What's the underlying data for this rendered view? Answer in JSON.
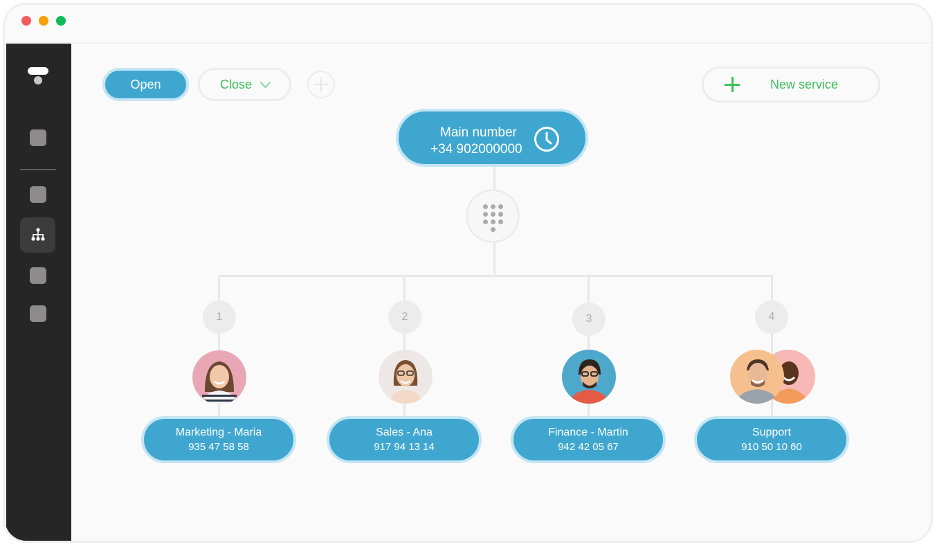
{
  "window": {
    "controls": [
      "close",
      "minimize",
      "maximize"
    ]
  },
  "sidebar": {
    "logo": "app-logo",
    "items": [
      {
        "name": "nav-item-1",
        "active": false
      },
      {
        "name": "nav-item-2",
        "active": false
      },
      {
        "name": "nav-item-call-flow",
        "icon": "org-chart-icon",
        "active": true
      },
      {
        "name": "nav-item-4",
        "active": false
      },
      {
        "name": "nav-item-5",
        "active": false
      }
    ]
  },
  "toolbar": {
    "open_label": "Open",
    "close_label": "Close",
    "add_icon": "plus-circle-icon",
    "new_service_label": "New service"
  },
  "flow": {
    "main": {
      "title": "Main number",
      "number": "+34 902000000",
      "icon": "clock-icon"
    },
    "menu_icon": "keypad-icon",
    "branches": [
      {
        "option": "1",
        "name": "Marketing - Maria",
        "phone": "935 47 58 58",
        "avatars": 1
      },
      {
        "option": "2",
        "name": "Sales - Ana",
        "phone": "917 94 13 14",
        "avatars": 1
      },
      {
        "option": "3",
        "name": "Finance - Martin",
        "phone": "942 42 05 67",
        "avatars": 1
      },
      {
        "option": "4",
        "name": "Support",
        "phone": "910 50 10 60",
        "avatars": 2
      }
    ]
  },
  "colors": {
    "primary": "#3fa7cf",
    "primary_border": "#c5e5f4",
    "accent_green": "#3dbe5a",
    "sidebar_bg": "#262626"
  }
}
